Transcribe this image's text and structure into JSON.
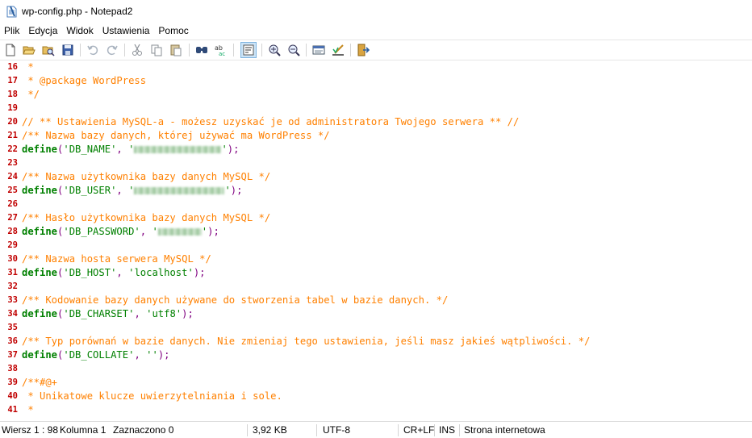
{
  "window": {
    "title": "wp-config.php - Notepad2"
  },
  "menu": [
    "Plik",
    "Edycja",
    "Widok",
    "Ustawienia",
    "Pomoc"
  ],
  "toolbar_icons": [
    "new-file-icon",
    "open-file-icon",
    "browse-icon",
    "save-icon",
    "undo-icon",
    "redo-icon",
    "cut-icon",
    "copy-icon",
    "paste-icon",
    "find-icon",
    "replace-icon",
    "word-wrap-icon",
    "zoom-in-icon",
    "zoom-out-icon",
    "scheme-icon",
    "customize-scheme-icon",
    "exit-icon"
  ],
  "editor": {
    "lines": [
      {
        "num": "16",
        "text": " *"
      },
      {
        "num": "17",
        "text": " * @package WordPress"
      },
      {
        "num": "18",
        "text": " */"
      },
      {
        "num": "19",
        "text": ""
      },
      {
        "num": "20",
        "text": "// ** Ustawienia MySQL-a - możesz uzyskać je od administratora Twojego serwera ** //"
      },
      {
        "num": "21",
        "text": "/** Nazwa bazy danych, której używać ma WordPress */"
      },
      {
        "num": "22",
        "keyword": "define",
        "const": "'DB_NAME'",
        "value": ""
      },
      {
        "num": "23",
        "text": ""
      },
      {
        "num": "24",
        "text": "/** Nazwa użytkownika bazy danych MySQL */"
      },
      {
        "num": "25",
        "keyword": "define",
        "const": "'DB_USER'",
        "value": ""
      },
      {
        "num": "26",
        "text": ""
      },
      {
        "num": "27",
        "text": "/** Hasło użytkownika bazy danych MySQL */"
      },
      {
        "num": "28",
        "keyword": "define",
        "const": "'DB_PASSWORD'",
        "value": ""
      },
      {
        "num": "29",
        "text": ""
      },
      {
        "num": "30",
        "text": "/** Nazwa hosta serwera MySQL */"
      },
      {
        "num": "31",
        "keyword": "define",
        "const": "'DB_HOST'",
        "value": "'localhost'"
      },
      {
        "num": "32",
        "text": ""
      },
      {
        "num": "33",
        "text": "/** Kodowanie bazy danych używane do stworzenia tabel w bazie danych. */"
      },
      {
        "num": "34",
        "keyword": "define",
        "const": "'DB_CHARSET'",
        "value": "'utf8'"
      },
      {
        "num": "35",
        "text": ""
      },
      {
        "num": "36",
        "text": "/** Typ porównań w bazie danych. Nie zmieniaj tego ustawienia, jeśli masz jakieś wątpliwości. */"
      },
      {
        "num": "37",
        "keyword": "define",
        "const": "'DB_COLLATE'",
        "value": "''"
      },
      {
        "num": "38",
        "text": ""
      },
      {
        "num": "39",
        "text": "/**#@+"
      },
      {
        "num": "40",
        "text": " * Unikatowe klucze uwierzytelniania i sole."
      },
      {
        "num": "41",
        "text": " *"
      }
    ]
  },
  "status": {
    "position": "Wiersz 1 : 98",
    "column": "Kolumna 1",
    "selection": "Zaznaczono 0",
    "size": "3,92 KB",
    "encoding": "UTF-8",
    "line_ending": "CR+LF",
    "insert_mode": "INS",
    "syntax": "Strona internetowa"
  },
  "colors": {
    "comment": "#ff8000",
    "keyword": "#008000",
    "string": "#008000",
    "punct": "#800080",
    "line_number": "#c00000"
  }
}
